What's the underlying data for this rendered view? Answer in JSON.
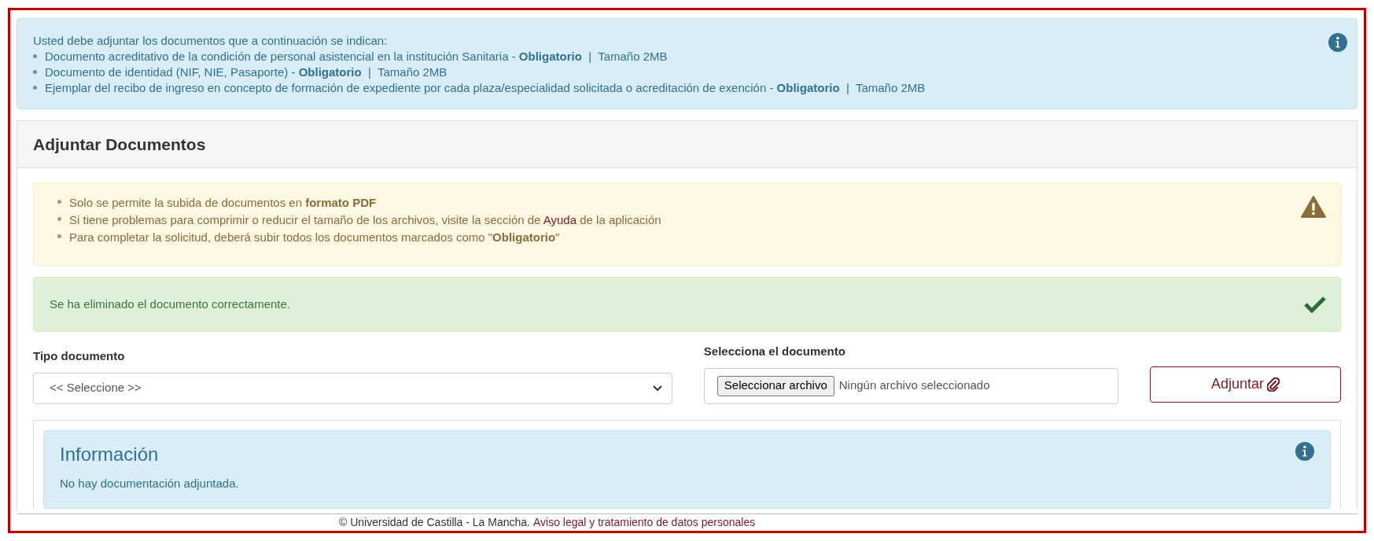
{
  "requirements": {
    "intro": "Usted debe adjuntar los documentos que a continuación se indican:",
    "items": [
      "Documento acreditativo de la condición de personal asistencial en la institución Sanitaria - **Obligatorio**  |  Tamaño 2MB",
      "Documento de identidad (NIF, NIE, Pasaporte) - **Obligatorio**  |  Tamaño 2MB",
      "Ejemplar del recibo de ingreso en concepto de formación de expediente por cada plaza/especialidad solicitada o acreditación de exención - **Obligatorio**  |  Tamaño 2MB"
    ]
  },
  "panel": {
    "title": "Adjuntar Documentos",
    "warning": {
      "items": [
        {
          "text": "Solo se permite la subida de documentos en **formato PDF**"
        },
        {
          "text": "Si tiene problemas para comprimir o reducir el tamaño de los archivos, visite la sección de",
          "link": "Ayuda",
          "after": "de la aplicación"
        },
        {
          "text": "Para completar la solicitud, deberá subir todos los documentos marcados como \"**Obligatorio**\""
        }
      ]
    },
    "success": "Se ha eliminado el documento correctamente.",
    "type_field": {
      "label": "Tipo documento",
      "value": "<< Seleccione >>"
    },
    "file_field": {
      "label": "Selecciona el documento",
      "button": "Seleccionar archivo",
      "status": "Ningún archivo seleccionado"
    },
    "attach_button": "Adjuntar",
    "info": {
      "title": "Información",
      "text": "No hay documentación adjuntada."
    }
  },
  "footer": {
    "text": "© Universidad de Castilla - La Mancha.",
    "link": "Aviso legal y tratamiento de datos personales"
  }
}
